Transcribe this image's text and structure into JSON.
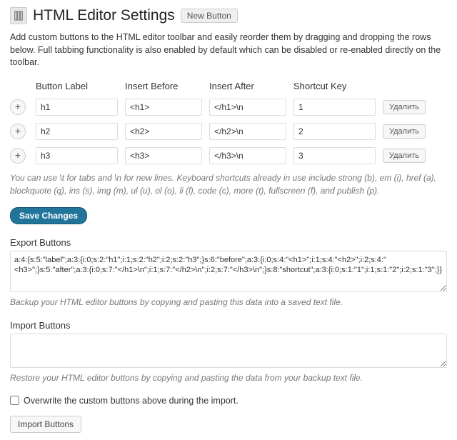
{
  "header": {
    "title": "HTML Editor Settings",
    "new_button": "New Button"
  },
  "description": "Add custom buttons to the HTML editor toolbar and easily reorder them by dragging and dropping the rows below. Full tabbing functionality is also enabled by default which can be disabled or re-enabled directly on the toolbar.",
  "columns": {
    "label": "Button Label",
    "before": "Insert Before",
    "after": "Insert After",
    "shortcut": "Shortcut Key"
  },
  "rows": [
    {
      "label": "h1",
      "before": "<h1>",
      "after": "</h1>\\n",
      "shortcut": "1"
    },
    {
      "label": "h2",
      "before": "<h2>",
      "after": "</h2>\\n",
      "shortcut": "2"
    },
    {
      "label": "h3",
      "before": "<h3>",
      "after": "</h3>\\n",
      "shortcut": "3"
    }
  ],
  "plus": "+",
  "delete_label": "Удалить",
  "usage_hint": "You can use \\t for tabs and \\n for new lines. Keyboard shortcuts already in use include strong (b), em (i), href (a), blockquote (q), ins (s), img (m), ul (u), ol (o), li (l), code (c), more (t), fullscreen (f), and publish (p).",
  "save_label": "Save Changes",
  "export": {
    "label": "Export Buttons",
    "value": "a:4:{s:5:\"label\";a:3:{i:0;s:2:\"h1\";i:1;s:2:\"h2\";i:2;s:2:\"h3\";}s:6:\"before\";a:3:{i:0;s:4:\"<h1>\";i:1;s:4:\"<h2>\";i:2;s:4:\"<h3>\";}s:5:\"after\";a:3:{i:0;s:7:\"</h1>\\n\";i:1;s:7:\"</h2>\\n\";i:2;s:7:\"</h3>\\n\";}s:8:\"shortcut\";a:3:{i:0;s:1:\"1\";i:1;s:1:\"2\";i:2;s:1:\"3\";}}",
    "hint": "Backup your HTML editor buttons by copying and pasting this data into a saved text file."
  },
  "import": {
    "label": "Import Buttons",
    "value": "",
    "hint": "Restore your HTML editor buttons by copying and pasting the data from your backup text file.",
    "overwrite": "Overwrite the custom buttons above during the import.",
    "button": "Import Buttons"
  }
}
